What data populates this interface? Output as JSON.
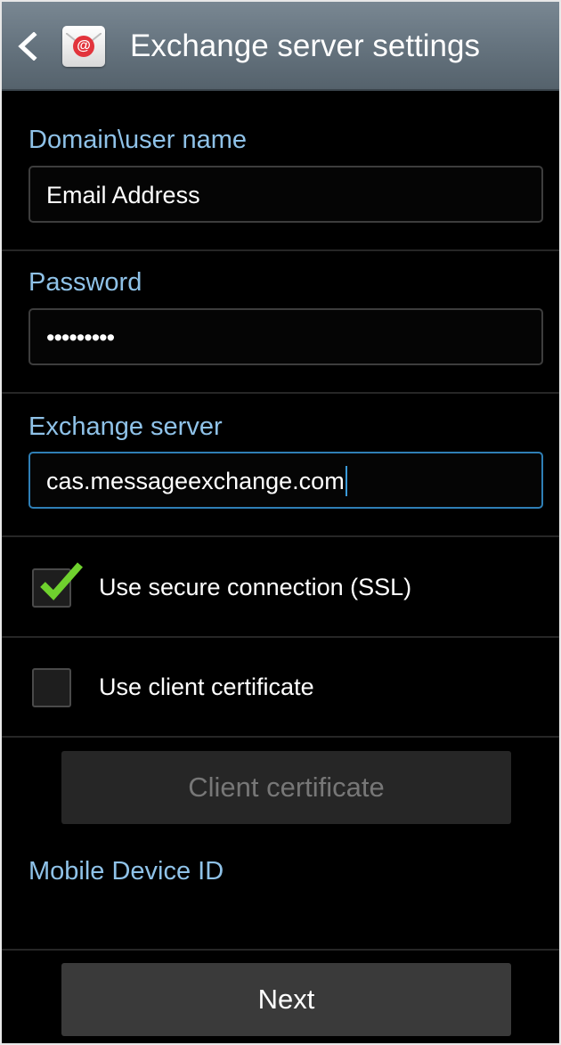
{
  "header": {
    "title": "Exchange server settings",
    "back_icon": "chevron-left-icon",
    "app_icon": "email-app-icon",
    "app_icon_glyph": "@"
  },
  "form": {
    "domain_user": {
      "label": "Domain\\user name",
      "value": "Email Address"
    },
    "password": {
      "label": "Password",
      "value": "•••••••••"
    },
    "exchange_server": {
      "label": "Exchange server",
      "value": "cas.messageexchange.com"
    },
    "ssl": {
      "label": "Use secure connection (SSL)",
      "checked": true
    },
    "client_certificate_option": {
      "label": "Use client certificate",
      "checked": false
    },
    "client_certificate_button": "Client certificate",
    "mobile_device_id_label": "Mobile Device ID"
  },
  "footer": {
    "next_label": "Next"
  },
  "colors": {
    "accent_label": "#8fc2e8",
    "focus_border": "#2f7fb6",
    "check_green": "#6fd12e",
    "actionbar": "#66747f"
  }
}
